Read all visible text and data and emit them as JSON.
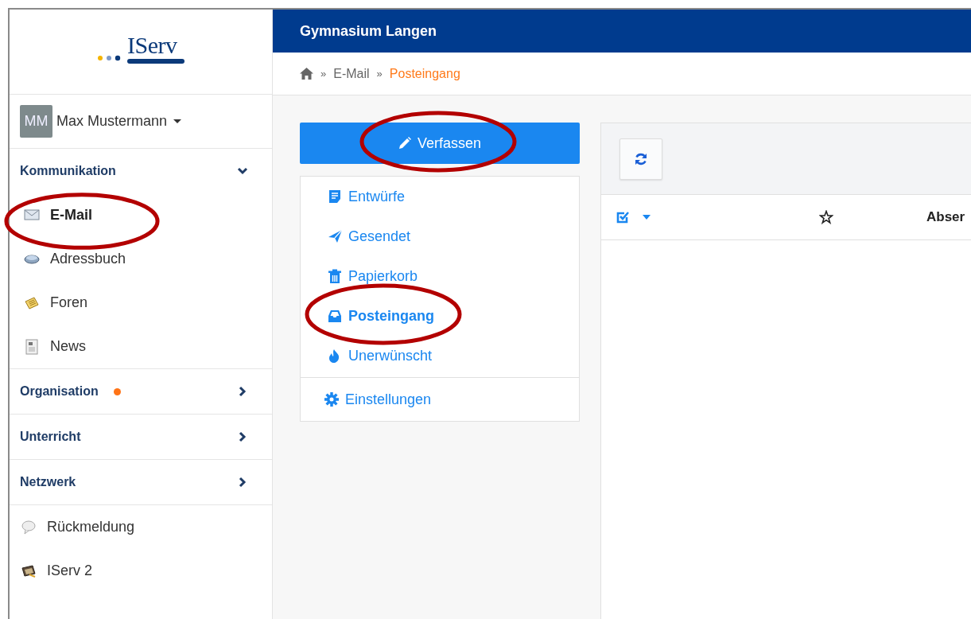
{
  "logo": {
    "text": "IServ"
  },
  "user": {
    "initials": "MM",
    "name": "Max Mustermann"
  },
  "sidebar": {
    "sections": [
      {
        "title": "Kommunikation",
        "expanded": true,
        "badge": false,
        "items": [
          {
            "label": "E-Mail",
            "selected": true,
            "circled": true
          },
          {
            "label": "Adressbuch",
            "selected": false,
            "circled": false
          },
          {
            "label": "Foren",
            "selected": false,
            "circled": false
          },
          {
            "label": "News",
            "selected": false,
            "circled": false
          }
        ]
      },
      {
        "title": "Organisation",
        "expanded": false,
        "badge": true
      },
      {
        "title": "Unterricht",
        "expanded": false,
        "badge": false
      },
      {
        "title": "Netzwerk",
        "expanded": false,
        "badge": false
      }
    ],
    "footer_items": [
      {
        "label": "Rückmeldung"
      },
      {
        "label": "IServ 2"
      }
    ]
  },
  "header": {
    "title": "Gymnasium Langen"
  },
  "breadcrumb": [
    {
      "kind": "separator",
      "text": "»"
    },
    {
      "kind": "link",
      "text": "E-Mail"
    },
    {
      "kind": "separator",
      "text": "»"
    },
    {
      "kind": "current",
      "text": "Posteingang"
    }
  ],
  "compose_button": {
    "label": "Verfassen",
    "circled": true
  },
  "folders": [
    {
      "label": "Entwürfe",
      "selected": false,
      "circled": false
    },
    {
      "label": "Gesendet",
      "selected": false,
      "circled": false
    },
    {
      "label": "Papierkorb",
      "selected": false,
      "circled": false
    },
    {
      "label": "Posteingang",
      "selected": true,
      "circled": true
    },
    {
      "label": "Unerwünscht",
      "selected": false,
      "circled": false
    }
  ],
  "settings_link": {
    "label": "Einstellungen"
  },
  "table": {
    "columns": [
      {
        "kind": "select"
      },
      {
        "kind": "star"
      },
      {
        "kind": "text",
        "label": "Abser"
      }
    ]
  }
}
